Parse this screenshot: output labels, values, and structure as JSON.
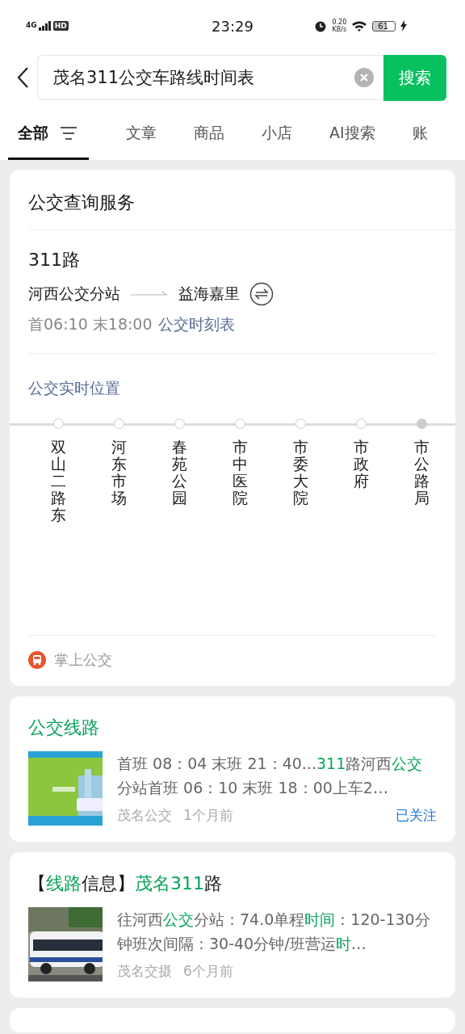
{
  "status_bar": {
    "network": "4G",
    "hd": "HD",
    "time": "23:29",
    "speed": "0.20",
    "speed_unit": "KB/s",
    "battery": "61"
  },
  "search": {
    "value": "茂名311公交车路线时间表",
    "button": "搜索"
  },
  "tabs": [
    {
      "label": "全部",
      "selected": true
    },
    {
      "label": "文章",
      "selected": false
    },
    {
      "label": "商品",
      "selected": false
    },
    {
      "label": "小店",
      "selected": false
    },
    {
      "label": "AI搜索",
      "selected": false
    },
    {
      "label": "账",
      "selected": false
    }
  ],
  "bus_card": {
    "title": "公交查询服务",
    "route": "311路",
    "from": "河西公交分站",
    "to": "益海嘉里",
    "hours": "首06:10 末18:00",
    "timetable_link": "公交时刻表",
    "realtime_label": "公交实时位置",
    "stops": [
      {
        "name": "双山二路东",
        "current": false
      },
      {
        "name": "河东市场",
        "current": false
      },
      {
        "name": "春苑公园",
        "current": false
      },
      {
        "name": "市中医院",
        "current": false
      },
      {
        "name": "市委大院",
        "current": false
      },
      {
        "name": "市政府",
        "current": false
      },
      {
        "name": "市公路局",
        "current": true
      }
    ],
    "source": "掌上公交"
  },
  "results": [
    {
      "kind": "picture",
      "title": [
        {
          "text": "公交线路",
          "highlight": true
        }
      ],
      "snippet": [
        {
          "text": "首班 08：04 末班 21：40...",
          "highlight": false
        },
        {
          "text": "311",
          "highlight": true
        },
        {
          "text": "路河西",
          "highlight": false
        },
        {
          "text": "公交",
          "highlight": true
        },
        {
          "text": "分站首班 06：10 末班 18：00上车2…",
          "highlight": false
        }
      ],
      "account": "茂名公交",
      "age": "1个月前",
      "followed": "已关注"
    },
    {
      "kind": "picture",
      "title": [
        {
          "text": "【",
          "highlight": false
        },
        {
          "text": "线路",
          "highlight": true
        },
        {
          "text": "信息】",
          "highlight": false
        },
        {
          "text": "茂名311",
          "highlight": true
        },
        {
          "text": "路",
          "highlight": false
        }
      ],
      "snippet": [
        {
          "text": "往河西",
          "highlight": false
        },
        {
          "text": "公交",
          "highlight": true
        },
        {
          "text": "分站：74.0单程",
          "highlight": false
        },
        {
          "text": "时间",
          "highlight": true
        },
        {
          "text": "：120-130分钟班次间隔：30-40分钟/班营运",
          "highlight": false
        },
        {
          "text": "时",
          "highlight": true
        },
        {
          "text": "…",
          "highlight": false
        }
      ],
      "account": "茂名交摄",
      "age": "6个月前"
    }
  ]
}
